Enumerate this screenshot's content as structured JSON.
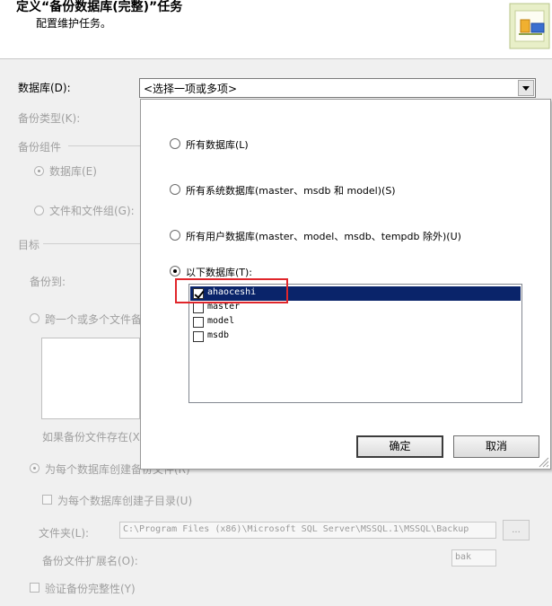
{
  "header": {
    "title": "定义“备份数据库(完整)”任务",
    "subtitle": "配置维护任务。"
  },
  "database": {
    "label": "数据库(D):",
    "selected": "<选择一项或多项>"
  },
  "backup_type": {
    "label": "备份类型(K):"
  },
  "backup_component": {
    "group_label": "备份组件",
    "option_database": "数据库(E)",
    "option_files": "文件和文件组(G):"
  },
  "destination": {
    "group_label": "目标",
    "backup_to_label": "备份到:",
    "option_span": "跨一个或多个文件备",
    "if_exists_label": "如果备份文件存在(X",
    "option_per_db": "为每个数据库创建备份文件(R)",
    "create_subdir_label": "为每个数据库创建子目录(U)",
    "folder_label": "文件夹(L):",
    "folder_path": "C:\\Program Files (x86)\\Microsoft SQL Server\\MSSQL.1\\MSSQL\\Backup",
    "browse_label": "...",
    "ext_label": "备份文件扩展名(O):",
    "ext_value": "bak"
  },
  "verify": {
    "label": "验证备份完整性(Y)"
  },
  "popup": {
    "options": [
      {
        "label": "所有数据库(L)",
        "selected": false
      },
      {
        "label": "所有系统数据库(master、msdb 和 model)(S)",
        "selected": false
      },
      {
        "label": "所有用户数据库(master、model、msdb、tempdb 除外)(U)",
        "selected": false
      },
      {
        "label": "以下数据库(T):",
        "selected": true
      }
    ],
    "databases": [
      {
        "name": "ahaoceshi",
        "checked": true,
        "selected": true
      },
      {
        "name": "master",
        "checked": false,
        "selected": false
      },
      {
        "name": "model",
        "checked": false,
        "selected": false
      },
      {
        "name": "msdb",
        "checked": false,
        "selected": false
      }
    ],
    "ok_label": "确定",
    "cancel_label": "取消"
  },
  "colors": {
    "selection": "#0a246a",
    "highlight_box": "#e0262b"
  }
}
